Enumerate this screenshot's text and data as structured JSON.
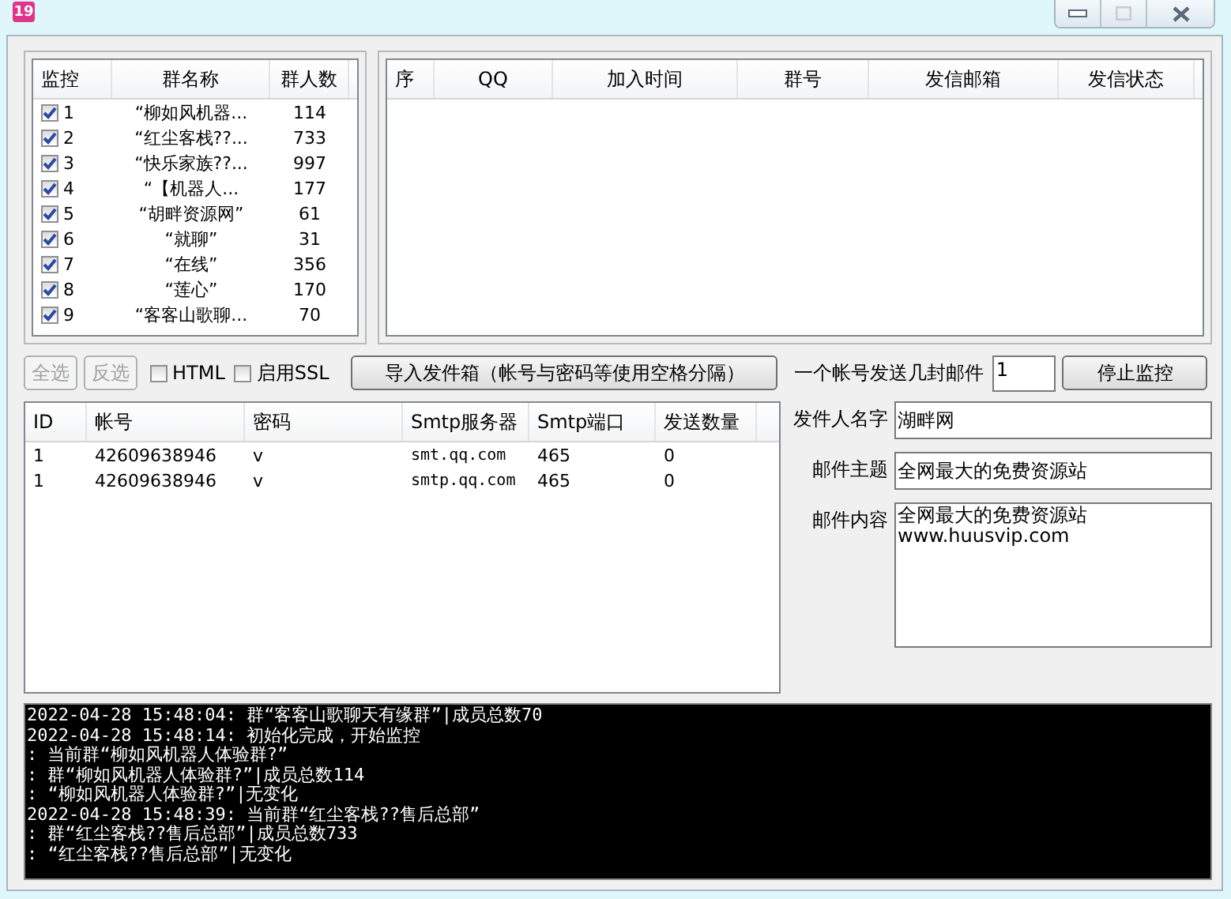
{
  "window": {
    "icon_text": "19"
  },
  "groups": {
    "columns": [
      "监控",
      "群名称",
      "群人数"
    ],
    "rows": [
      {
        "checked": true,
        "index": "1",
        "name": "“柳如风机器...",
        "members": "114"
      },
      {
        "checked": true,
        "index": "2",
        "name": "“红尘客栈??...",
        "members": "733"
      },
      {
        "checked": true,
        "index": "3",
        "name": "“快乐家族??...",
        "members": "997"
      },
      {
        "checked": true,
        "index": "4",
        "name": "“【机器人...",
        "members": "177"
      },
      {
        "checked": true,
        "index": "5",
        "name": "“胡畔资源网”",
        "members": "61"
      },
      {
        "checked": true,
        "index": "6",
        "name": "“就聊”",
        "members": "31"
      },
      {
        "checked": true,
        "index": "7",
        "name": "“在线”",
        "members": "356"
      },
      {
        "checked": true,
        "index": "8",
        "name": "“莲心”",
        "members": "170"
      },
      {
        "checked": true,
        "index": "9",
        "name": "“客客山歌聊...",
        "members": "70"
      }
    ]
  },
  "members_table": {
    "columns": [
      "序",
      "QQ",
      "加入时间",
      "群号",
      "发信邮箱",
      "发信状态"
    ]
  },
  "toolbar": {
    "buttons": [
      {
        "label": "全选",
        "disabled": true
      },
      {
        "label": "反选",
        "disabled": true
      }
    ],
    "options": [
      {
        "label": "HTML",
        "checked": false
      },
      {
        "label": "启用SSL",
        "checked": false
      }
    ],
    "import_button": "导入发件箱（帐号与密码等使用空格分隔）",
    "per_account_label": "一个帐号发送几封邮件",
    "per_account_value": "1",
    "stop_button": "停止监控"
  },
  "accounts": {
    "columns": [
      "ID",
      "帐号",
      "密码",
      "Smtp服务器",
      "Smtp端口",
      "发送数量"
    ],
    "rows": [
      [
        "1",
        "42609638946",
        "v",
        "smt.qq.com",
        "465",
        "0"
      ],
      [
        "1",
        "42609638946",
        "v",
        "smtp.qq.com",
        "465",
        "0"
      ]
    ]
  },
  "mail": {
    "fields": [
      {
        "kind": "line",
        "label": "发件人名字",
        "value": "湖畔网"
      },
      {
        "kind": "line",
        "label": "邮件主题",
        "value": "全网最大的免费资源站"
      },
      {
        "kind": "area",
        "label": "邮件内容",
        "value": "全网最大的免费资源站\nwww.huusvip.com"
      }
    ]
  },
  "log": [
    "2022-04-28 15:48:04: 群“客客山歌聊天有缘群”|成员总数70",
    "2022-04-28 15:48:14: 初始化完成，开始监控",
    ": 当前群“柳如风机器人体验群?”",
    ": 群“柳如风机器人体验群?”|成员总数114",
    ": “柳如风机器人体验群?”|无变化",
    "2022-04-28 15:48:39: 当前群“红尘客栈??售后总部”",
    ": 群“红尘客栈??售后总部”|成员总数733",
    ": “红尘客栈??售后总部”|无变化"
  ]
}
